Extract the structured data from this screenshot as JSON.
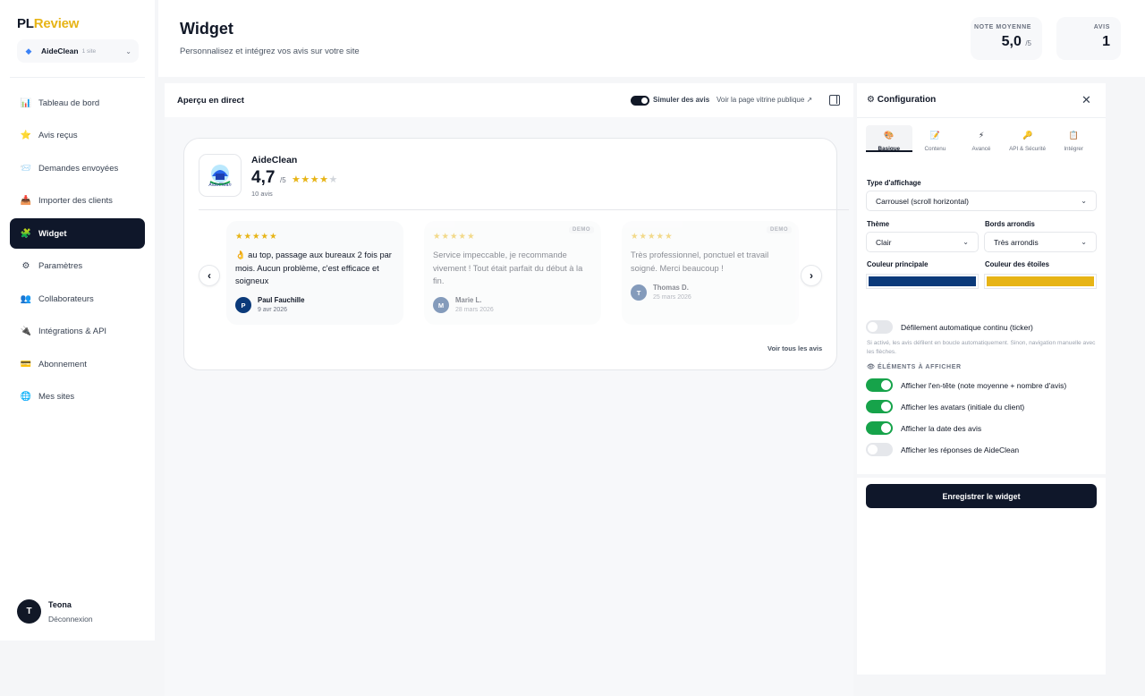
{
  "brand": {
    "part1": "PL",
    "part2": "Review"
  },
  "site_picker": {
    "name": "AideClean",
    "count": "1 site"
  },
  "sidebar": {
    "items": [
      {
        "label": "Tableau de bord",
        "icon": "📊"
      },
      {
        "label": "Avis reçus",
        "icon": "⭐"
      },
      {
        "label": "Demandes envoyées",
        "icon": "📨"
      },
      {
        "label": "Importer des clients",
        "icon": "📥"
      },
      {
        "label": "Widget",
        "icon": "🧩"
      },
      {
        "label": "Paramètres",
        "icon": "⚙"
      },
      {
        "label": "Collaborateurs",
        "icon": "👥"
      },
      {
        "label": "Intégrations & API",
        "icon": "🔌"
      },
      {
        "label": "Abonnement",
        "icon": "💳"
      },
      {
        "label": "Mes sites",
        "icon": "🌐"
      }
    ],
    "active_index": 4
  },
  "user": {
    "initial": "T",
    "name": "Teona",
    "logout": "Déconnexion"
  },
  "header": {
    "title": "Widget",
    "subtitle": "Personnalisez et intégrez vos avis sur votre site",
    "stat_avg_label": "NOTE MOYENNE",
    "stat_avg_value": "5,0",
    "stat_avg_unit": "/5",
    "stat_count_label": "AVIS",
    "stat_count_value": "1"
  },
  "preview": {
    "title": "Aperçu en direct",
    "simulate_label": "Simuler des avis",
    "simulate_on": true,
    "public_link": "Voir la page vitrine publique ↗"
  },
  "widget": {
    "business_name": "AideClean",
    "rating": "4,7",
    "rating_unit": "/5",
    "stars_filled": 4,
    "stars_total": 5,
    "review_count": "10 avis",
    "prev_arrow": "‹",
    "next_arrow": "›",
    "see_all": "Voir tous les avis",
    "reviews": [
      {
        "stars": "★★★★★",
        "text": "👌 au top, passage aux bureaux 2 fois par mois. Aucun problème, c'est efficace et soigneux",
        "initial": "P",
        "name": "Paul Fauchille",
        "date": "9 avr 2026",
        "demo": false,
        "badge": "",
        "avatar_color": "#0b3a7a"
      },
      {
        "stars": "★★★★★",
        "text": "Service impeccable, je recommande vivement ! Tout était parfait du début à la fin.",
        "initial": "M",
        "name": "Marie L.",
        "date": "28 mars 2026",
        "demo": true,
        "badge": "DEMO",
        "avatar_color": "#0b3a7a"
      },
      {
        "stars": "★★★★★",
        "text": "Très professionnel, ponctuel et travail soigné. Merci beaucoup !",
        "initial": "T",
        "name": "Thomas D.",
        "date": "25 mars 2026",
        "demo": true,
        "badge": "DEMO",
        "avatar_color": "#0b3a7a"
      }
    ]
  },
  "config": {
    "title": "Configuration",
    "title_icon": "⚙",
    "close": "✕",
    "tabs": [
      {
        "label": "Basique",
        "icon": "🎨"
      },
      {
        "label": "Contenu",
        "icon": "📝"
      },
      {
        "label": "Avancé",
        "icon": "⚡"
      },
      {
        "label": "API & Sécurité",
        "icon": "🔑"
      },
      {
        "label": "Intégrer",
        "icon": "📋"
      }
    ],
    "active_tab": 0,
    "display_type_label": "Type d'affichage",
    "display_type_value": "Carrousel (scroll horizontal)",
    "theme_label": "Thème",
    "theme_value": "Clair",
    "radius_label": "Bords arrondis",
    "radius_value": "Très arrondis",
    "primary_color_label": "Couleur principale",
    "primary_color": "#0b3a7a",
    "star_color_label": "Couleur des étoiles",
    "star_color": "#e7b416",
    "ticker_label": "Défilement automatique continu (ticker)",
    "ticker_on": false,
    "ticker_help": "Si activé, les avis défilent en boucle automatiquement. Sinon, navigation manuelle avec les flèches.",
    "elements_title": "👁 ÉLÉMENTS À AFFICHER",
    "toggles": [
      {
        "label": "Afficher l'en-tête (note moyenne + nombre d'avis)",
        "on": true
      },
      {
        "label": "Afficher les avatars (initiale du client)",
        "on": true
      },
      {
        "label": "Afficher la date des avis",
        "on": true
      },
      {
        "label": "Afficher les réponses de AideClean",
        "on": false
      }
    ],
    "save_label": "Enregistrer le widget"
  },
  "colors": {
    "accent": "#0f172a",
    "brand_yellow": "#e7b416",
    "toggle_on": "#16a34a"
  }
}
